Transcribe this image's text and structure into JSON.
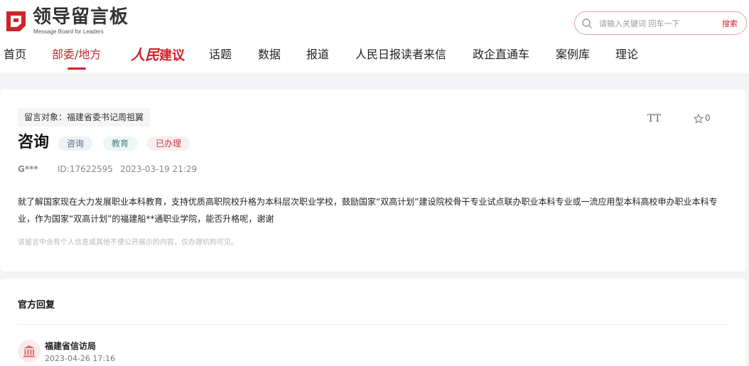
{
  "logo": {
    "title": "领导留言板",
    "subtitle": "Message Board for Leaders"
  },
  "search": {
    "placeholder": "请输入关键词 回车一下",
    "button_label": "搜索"
  },
  "nav": {
    "items": [
      "首页",
      "部委/地方",
      "话题",
      "数据",
      "报道",
      "人民日报读者来信",
      "政企直通车",
      "案例库",
      "理论"
    ],
    "active": "部委/地方",
    "special": {
      "script": "人民",
      "label": "建议"
    }
  },
  "message": {
    "target": "留言对象：福建省委书记周祖翼",
    "title": "咨询",
    "tags": [
      "咨询",
      "教育",
      "已办理"
    ],
    "author": "G***",
    "id": "ID:17622595",
    "datetime": "2023-03-19 21:29",
    "content": "就了解国家现在大力发展职业本科教育，支持优质高职院校升格为本科层次职业学校，鼓励国家“双高计划”建设院校骨干专业试点联办职业本科专业或一流应用型本科高校申办职业本科专业，作为国家“双高计划”的福建船**通职业学院，能否升格呢，谢谢",
    "notice": "该留言中含有个人信息或其他不便公开展示的内容，仅办理机构可见。",
    "font_button": "TT",
    "star_count": "0"
  },
  "reply": {
    "section_title": "官方回复",
    "org_name": "福建省信访局",
    "date": "2023-04-26 17:16"
  },
  "colors": {
    "accent": "#d0222b",
    "background": "#f4f4f6"
  },
  "icons": [
    "logo-mark-icon",
    "search-icon",
    "star-icon",
    "building-icon"
  ]
}
